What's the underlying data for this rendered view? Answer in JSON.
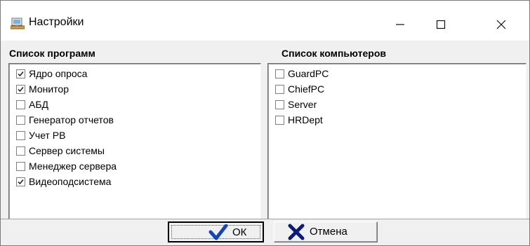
{
  "window": {
    "title": "Настройки"
  },
  "programs": {
    "label": "Список программ",
    "items": [
      {
        "label": "Ядро опроса",
        "checked": true
      },
      {
        "label": "Монитор",
        "checked": true
      },
      {
        "label": "АБД",
        "checked": false
      },
      {
        "label": "Генератор отчетов",
        "checked": false
      },
      {
        "label": "Учет РВ",
        "checked": false
      },
      {
        "label": "Сервер системы",
        "checked": false
      },
      {
        "label": "Менеджер сервера",
        "checked": false
      },
      {
        "label": "Видеоподсистема",
        "checked": true
      }
    ]
  },
  "computers": {
    "label": "Список компьютеров",
    "items": [
      {
        "label": "GuardPC",
        "checked": false
      },
      {
        "label": "ChiefPC",
        "checked": false
      },
      {
        "label": "Server",
        "checked": false
      },
      {
        "label": "HRDept",
        "checked": false
      }
    ]
  },
  "buttons": {
    "ok": "ОК",
    "cancel": "Отмена"
  },
  "colors": {
    "ok_icon": "#1446b8",
    "cancel_icon": "#0c1a78"
  }
}
